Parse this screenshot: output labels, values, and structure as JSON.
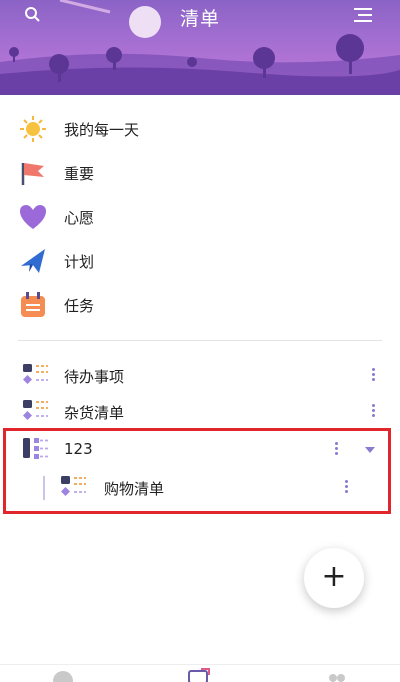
{
  "header": {
    "title": "清单"
  },
  "nav": [
    {
      "label": "我的每一天",
      "icon": "sun-icon"
    },
    {
      "label": "重要",
      "icon": "flag-icon"
    },
    {
      "label": "心愿",
      "icon": "heart-icon"
    },
    {
      "label": "计划",
      "icon": "paper-plane-icon"
    },
    {
      "label": "任务",
      "icon": "calendar-icon"
    }
  ],
  "lists": [
    {
      "label": "待办事项"
    },
    {
      "label": "杂货清单"
    }
  ],
  "group": {
    "label": "123",
    "children": [
      {
        "label": "购物清单"
      }
    ]
  },
  "fab": {
    "label": "+"
  },
  "colors": {
    "accent": "#8a7ad0",
    "highlight_box": "#e0262a"
  }
}
